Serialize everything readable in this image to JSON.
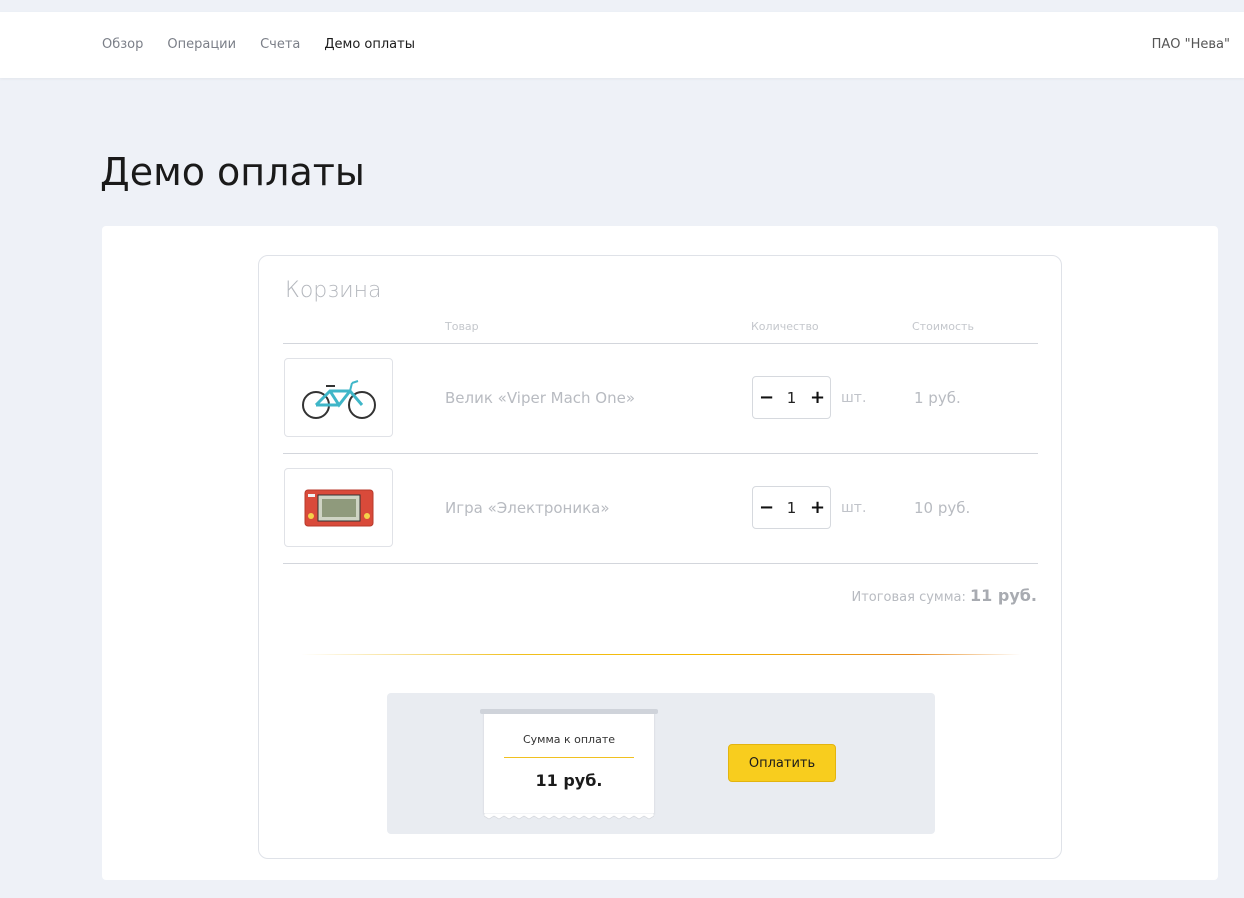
{
  "nav": {
    "links": [
      "Обзор",
      "Операции",
      "Счета",
      "Демо оплаты"
    ],
    "org": "ПАО \"Нева\""
  },
  "page_title": "Демо оплаты",
  "cart": {
    "title": "Корзина",
    "columns": {
      "item": "Товар",
      "quantity": "Количество",
      "cost": "Стоимость"
    },
    "items": [
      {
        "name": "Велик «Viper Mach One»",
        "quantity": "1",
        "unit": "шт.",
        "price": "1 руб.",
        "image": "bicycle-image"
      },
      {
        "name": "Игра «Электроника»",
        "quantity": "1",
        "unit": "шт.",
        "price": "10 руб.",
        "image": "handheld-game-image"
      }
    ],
    "total_label": "Итоговая сумма:",
    "total_value": "11 руб."
  },
  "payment": {
    "receipt_label": "Сумма к оплате",
    "receipt_amount": "11 руб.",
    "pay_button": "Оплатить"
  },
  "colors": {
    "page_bg": "#eef1f7",
    "accent_yellow": "#f8cd1e"
  }
}
